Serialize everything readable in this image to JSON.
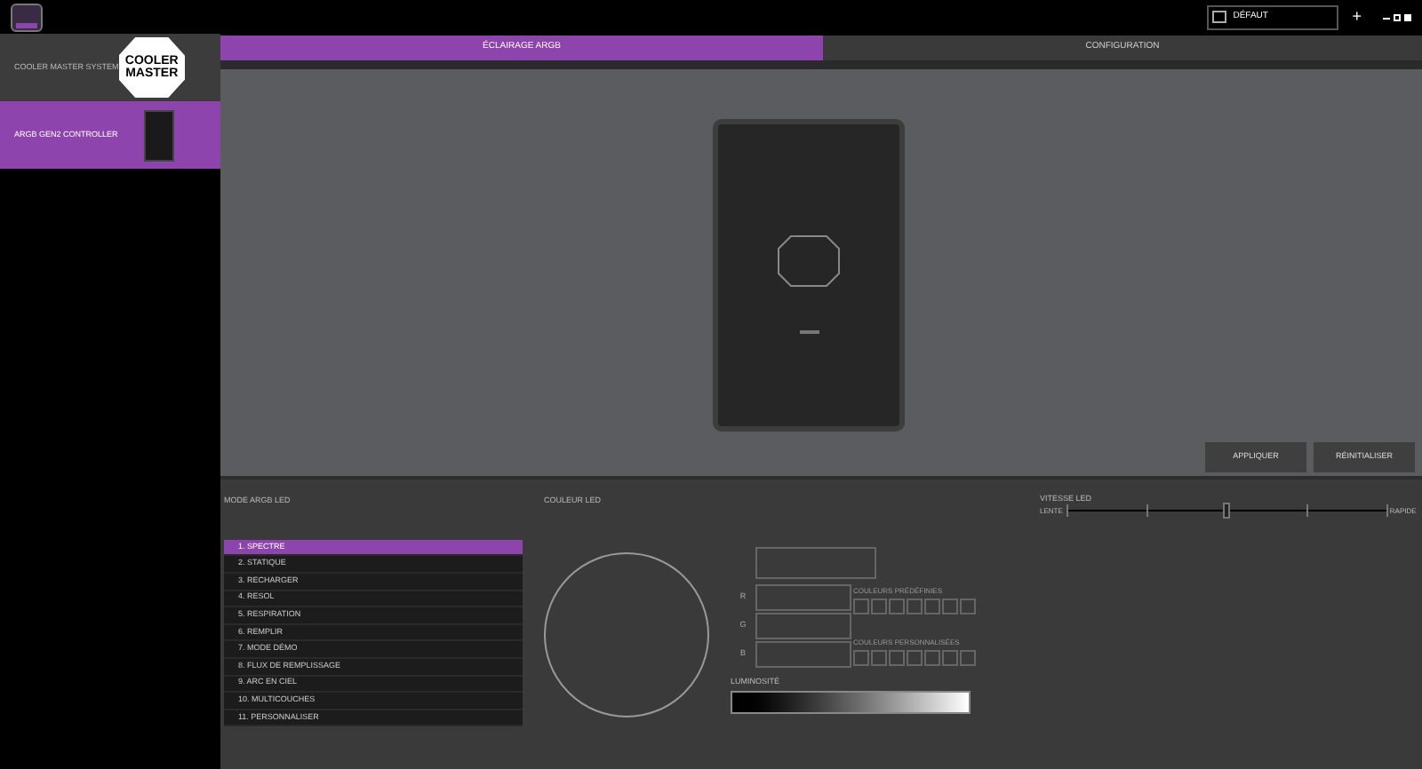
{
  "titlebar": {
    "profile": "DÉFAUT",
    "add": "+"
  },
  "sidebar": {
    "items": [
      {
        "label": "COOLER MASTER SYSTEM",
        "kind": "logo",
        "logo": [
          "COOLER",
          "MASTER"
        ],
        "selected": false
      },
      {
        "label": "ARGB GEN2 CONTROLLER",
        "kind": "device",
        "selected": true
      }
    ]
  },
  "tabs": [
    {
      "label": "ÉCLAIRAGE ARGB",
      "selected": true
    },
    {
      "label": "CONFIGURATION",
      "selected": false
    }
  ],
  "actions": [
    "APPLIQUER",
    "RÉINITIALISER"
  ],
  "mode_panel": {
    "title": "MODE ARGB LED",
    "modes": [
      {
        "label": "1. SPECTRE",
        "selected": true
      },
      {
        "label": "2. STATIQUE",
        "selected": false
      },
      {
        "label": "3. RECHARGER",
        "selected": false
      },
      {
        "label": "4. RESOL",
        "selected": false
      },
      {
        "label": "5. RESPIRATION",
        "selected": false
      },
      {
        "label": "6. REMPLIR",
        "selected": false
      },
      {
        "label": "7. MODE DÉMO",
        "selected": false
      },
      {
        "label": "8. FLUX DE REMPLISSAGE",
        "selected": false
      },
      {
        "label": "9. ARC EN CIEL",
        "selected": false
      },
      {
        "label": "10. MULTICOUCHES",
        "selected": false
      },
      {
        "label": "11. PERSONNALISER",
        "selected": false
      }
    ]
  },
  "color_panel": {
    "title": "COULEUR LED",
    "channels": [
      "R",
      "G",
      "B"
    ],
    "preset_title": "COULEURS PRÉDÉFINIES",
    "custom_title": "COULEURS PERSONNALISÉES",
    "brightness_title": "LUMINOSITÉ"
  },
  "speed": {
    "title": "VITESSE LED",
    "min_label": "LENTE",
    "max_label": "RAPIDE",
    "level": 0.5
  }
}
